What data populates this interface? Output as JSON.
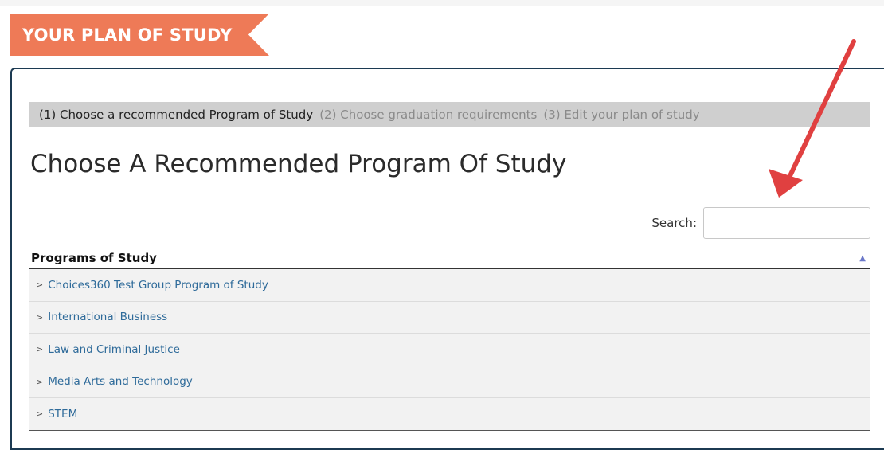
{
  "banner": {
    "title": "YOUR PLAN OF STUDY"
  },
  "steps": [
    {
      "label": "(1) Choose a recommended Program of Study",
      "active": true
    },
    {
      "label": "(2) Choose graduation requirements",
      "active": false
    },
    {
      "label": "(3) Edit your plan of study",
      "active": false
    }
  ],
  "main": {
    "title": "Choose A Recommended Program Of Study"
  },
  "search": {
    "label": "Search:",
    "value": "",
    "placeholder": ""
  },
  "table": {
    "header": "Programs of Study",
    "sort_icon": "sort-ascending-icon",
    "rows": [
      "Choices360 Test Group Program of Study",
      "International Business",
      "Law and Criminal Justice",
      "Media Arts and Technology",
      "STEM"
    ]
  },
  "colors": {
    "banner": "#ee7a57",
    "panel_border": "#1c3a52",
    "link": "#2f6b9a",
    "annotation_arrow": "#e04040"
  }
}
